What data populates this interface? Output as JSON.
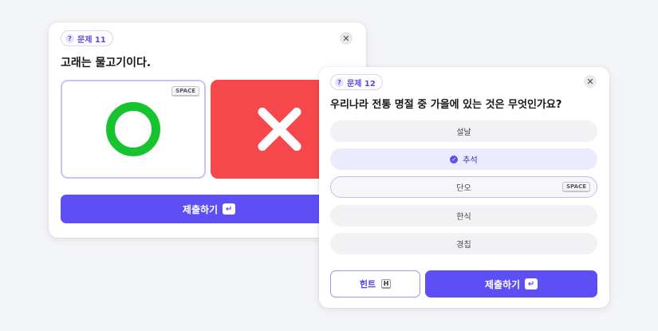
{
  "card1": {
    "badge": "문제 11",
    "question": "고래는 물고기이다.",
    "key_hint": "SPACE",
    "submit_label": "제출하기",
    "close_glyph": "✕"
  },
  "card2": {
    "badge": "문제 12",
    "question": "우리나라 전통 명절 중 가을에 있는 것은 무엇인가요?",
    "choices": [
      "설날",
      "추석",
      "단오",
      "한식",
      "경칩"
    ],
    "selected_choice": "추석",
    "key_hint": "SPACE",
    "hint_label": "힌트",
    "hint_key": "H",
    "submit_label": "제출하기",
    "close_glyph": "✕"
  },
  "icons": {
    "badge": "question-icon",
    "close": "close-icon",
    "true_option": "circle-o-icon",
    "false_option": "x-mark-icon",
    "selected": "check-circle-icon",
    "enter": "enter-key-icon"
  },
  "colors": {
    "accent": "#5e4ff5",
    "correct_green": "#17c32f",
    "wrong_red": "#f6474a"
  }
}
